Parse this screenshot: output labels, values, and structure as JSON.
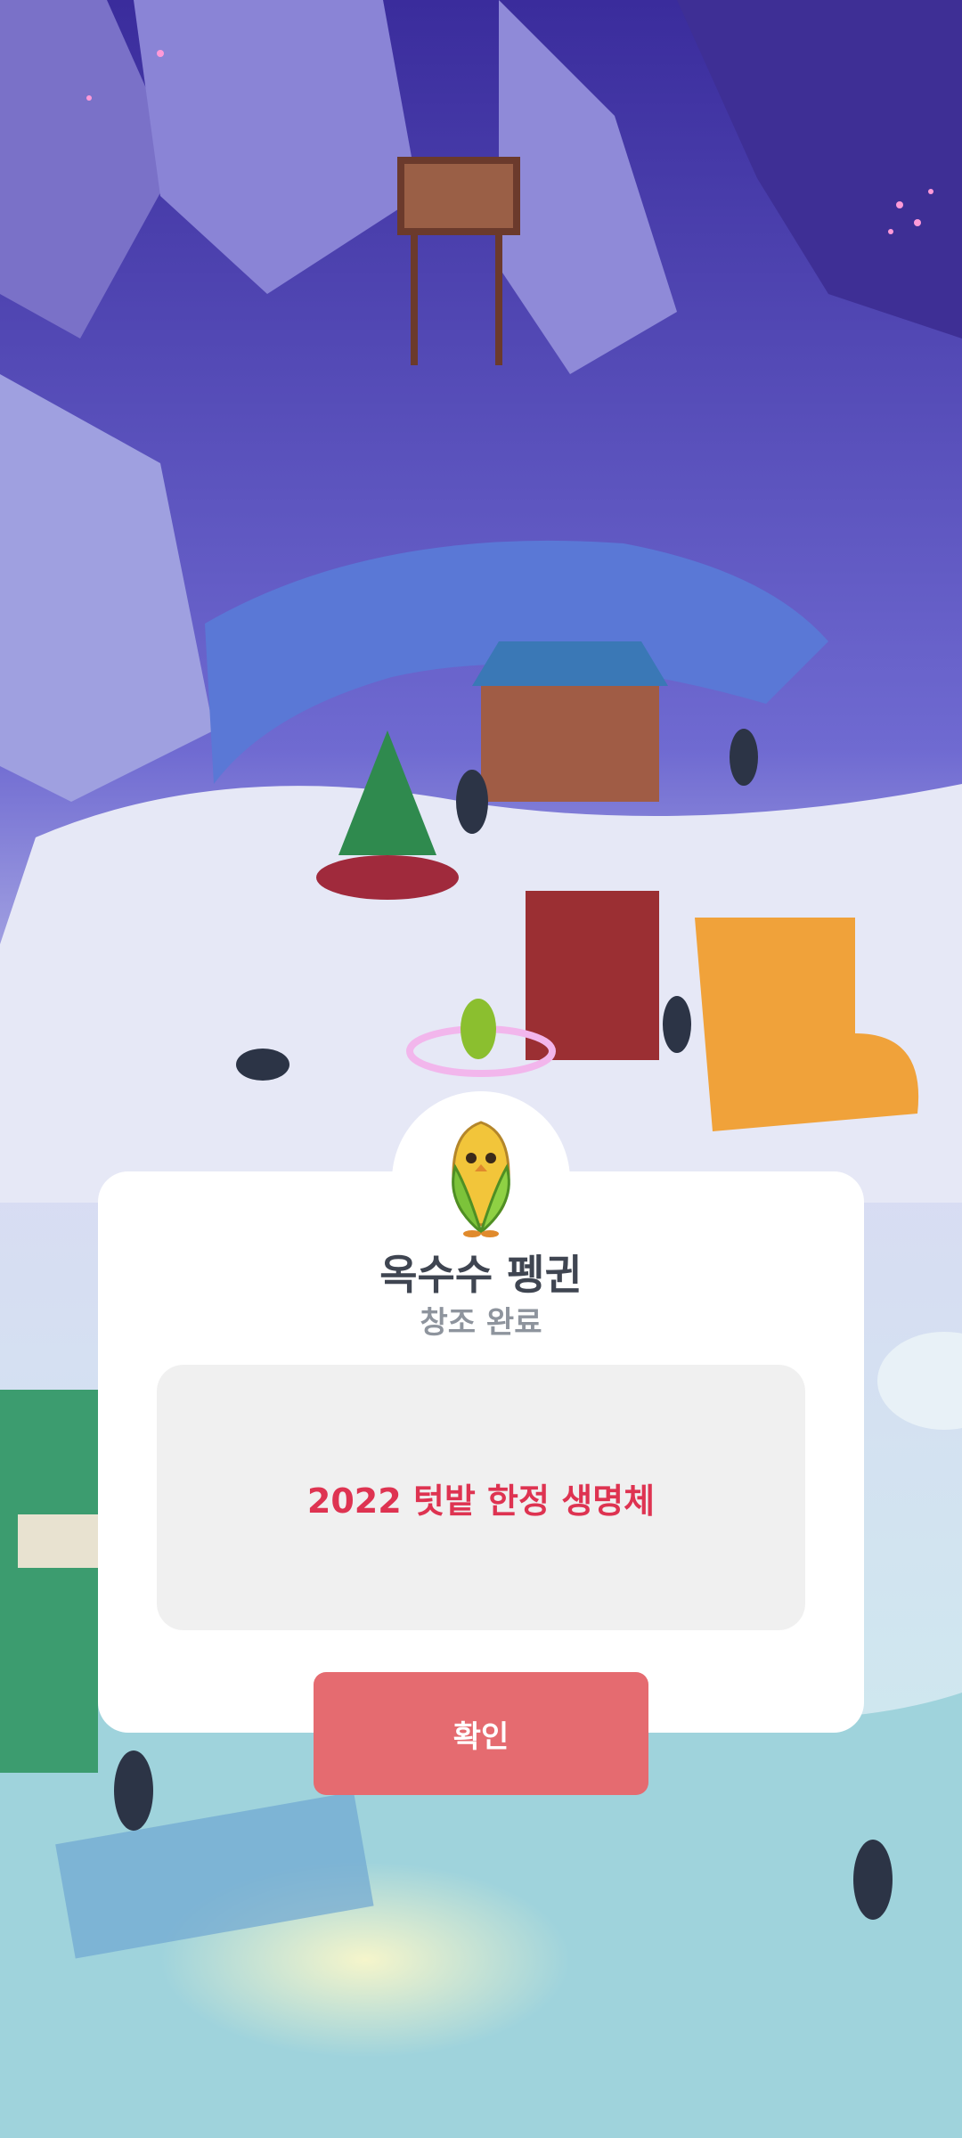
{
  "dialog": {
    "creature_icon": "corn-penguin-icon",
    "title": "옥수수 펭귄",
    "subtitle": "창조 완료",
    "description": "2022 텃밭 한정 생명체",
    "confirm_label": "확인"
  },
  "colors": {
    "title": "#3f4551",
    "subtitle": "#8e949d",
    "description": "#de3351",
    "confirm_button": "#e56b70",
    "info_box": "#f0f0f0"
  }
}
